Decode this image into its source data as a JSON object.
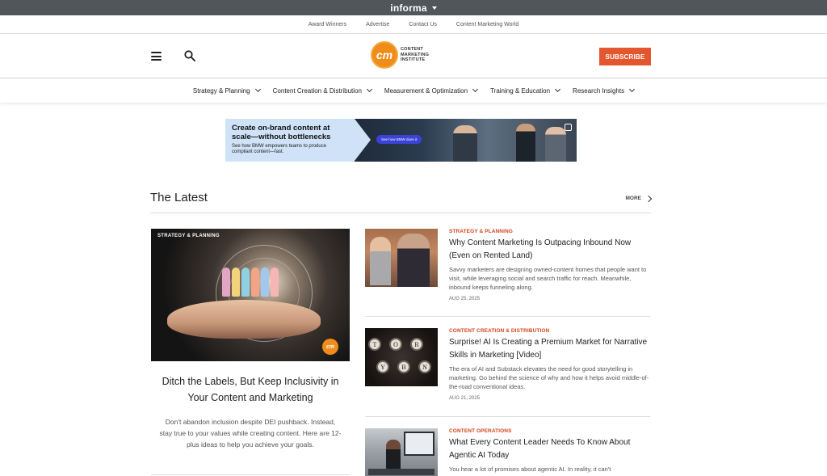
{
  "informa": {
    "label": "informa"
  },
  "utility_nav": [
    "Award Winners",
    "Advertise",
    "Contact Us",
    "Content Marketing World"
  ],
  "header": {
    "logo_mark": "cm",
    "logo_text": "CONTENT MARKETING INSTITUTE",
    "subscribe": "SUBSCRIBE"
  },
  "main_nav": [
    "Strategy & Planning",
    "Content Creation & Distribution",
    "Measurement & Optimization",
    "Training & Education",
    "Research Insights"
  ],
  "ad": {
    "headline": "Create on-brand content at scale—without bottlenecks",
    "sub": "See how BMW empowers teams to produce compliant content—fast.",
    "cta": "See how BMW does it"
  },
  "latest": {
    "title": "The Latest",
    "more": "MORE"
  },
  "featured": {
    "tag": "STRATEGY & PLANNING",
    "title": "Ditch the Labels, But Keep Inclusivity in Your Content and Marketing",
    "description": "Don't abandon inclusion despite DEI pushback. Instead, stay true to your values while creating content. Here are 12-plus ideas to help you achieve your goals."
  },
  "articles": [
    {
      "category": "Strategy & Planning",
      "title": "Why Content Marketing Is Outpacing Inbound Now (Even on Rented Land)",
      "description": "Savvy marketers are designing owned-content homes that people want to visit, while leveraging social and search traffic for reach. Meanwhile, inbound keeps funneling along.",
      "date": "AUG 25, 2025"
    },
    {
      "category": "Content Creation & Distribution",
      "title": "Surprise! AI Is Creating a Premium Market for Narrative Skills in Marketing [Video]",
      "description": "The era of AI and Substack elevates the need for good storytelling in marketing. Go behind the science of why and how it helps avoid middle-of-the-road conventional ideas.",
      "date": "AUG 21, 2025"
    },
    {
      "category": "Content Operations",
      "title": "What Every Content Leader Needs To Know About Agentic AI Today",
      "description": "You hear a lot of promises about agentic AI. In reality, it can't",
      "date": ""
    }
  ],
  "typewriter_keys": [
    "T",
    "O",
    "R",
    "Y",
    "B",
    "N"
  ]
}
